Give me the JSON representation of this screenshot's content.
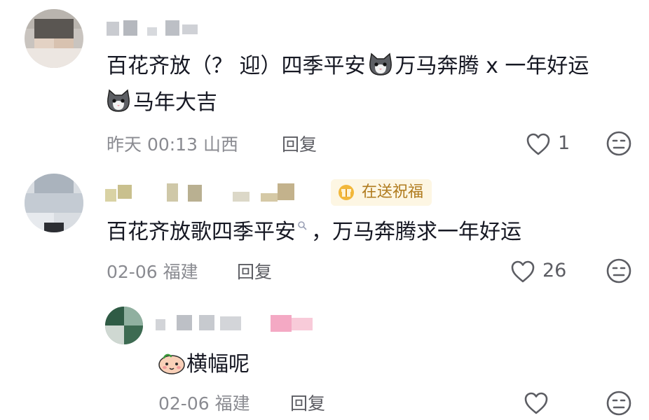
{
  "comments": [
    {
      "text_part1": "百花齐放（？ 迎）四季平安",
      "text_part2": "万马奔腾 x 一年好运",
      "text_line2": "马年大吉",
      "meta": "昨天 00:13 山西",
      "reply_label": "回复",
      "likes": "1"
    },
    {
      "badge": "在送祝福",
      "text_part1": "百花齐放歌四季平安",
      "text_part2": "，万马奔腾求一年好运",
      "meta": "02-06 福建",
      "reply_label": "回复",
      "likes": "26"
    },
    {
      "text": "横幅呢",
      "meta": "02-06 福建",
      "reply_label": "回复",
      "likes": ""
    }
  ],
  "colors": {
    "text": "#161823",
    "meta": "#8a8b91",
    "badge_bg": "#fdf6e3",
    "badge_text": "#b07b1e"
  }
}
